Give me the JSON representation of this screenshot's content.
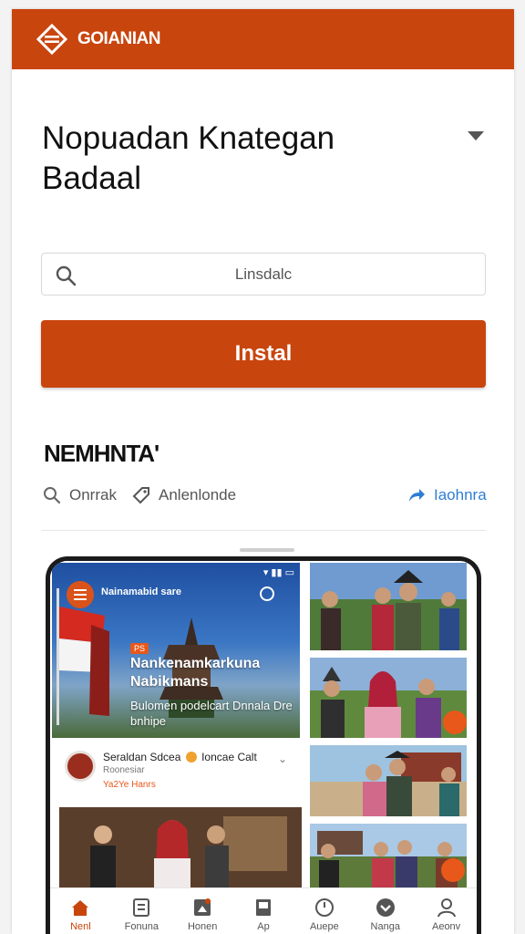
{
  "header": {
    "brand": "GOIANIAN",
    "brand_color": "#c9450e",
    "logo_icon": "diamond-logo-icon"
  },
  "app": {
    "title": "Nopuadan Knategan Badaal",
    "search_placeholder": "Linsdalc",
    "install_label": "Instal"
  },
  "section": {
    "title": "NEMHNTA'",
    "actions": [
      {
        "icon": "search-icon",
        "label": "Onrrak"
      },
      {
        "icon": "tag-icon",
        "label": "Anlenlonde"
      }
    ],
    "share": {
      "icon": "share-icon",
      "label": "Iaohnra"
    }
  },
  "preview": {
    "hero": {
      "header": "Nainamabid sare",
      "badge": "PS",
      "title": "Nankenamkarkuna Nabikmans",
      "subtitle": "Bulomen podelcart Dnnala Dre bnhipe"
    },
    "post": {
      "name_a": "Seraldan Sdcea",
      "name_b": "Ioncae Calt",
      "meta": "Roonesiar",
      "rating": "Ya2Ye   Hanrs"
    },
    "nav": [
      {
        "icon": "home-icon",
        "label": "Nenl"
      },
      {
        "icon": "list-icon",
        "label": "Fonuna"
      },
      {
        "icon": "grid-icon",
        "label": "Honen"
      },
      {
        "icon": "book-icon",
        "label": "Ap"
      },
      {
        "icon": "clock-icon",
        "label": "Auepe"
      },
      {
        "icon": "heart-icon",
        "label": "Nanga"
      },
      {
        "icon": "profile-icon",
        "label": "Aeonv"
      }
    ]
  }
}
